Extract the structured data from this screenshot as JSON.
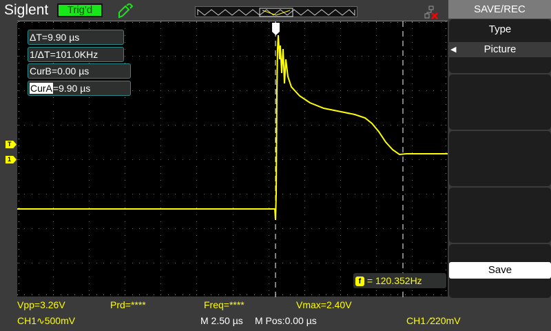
{
  "header": {
    "brand": "Siglent",
    "trigger_status": "Trig'd",
    "icons": [
      "probe-icon",
      "network-disconnected-icon"
    ]
  },
  "cursors": {
    "delta_t": "ΔT=9.90 µs",
    "inv_delta_t": "1/ΔT=101.0KHz",
    "cur_b": "CurB=0.00 µs",
    "cur_a_label": "CurA",
    "cur_a_value": "=9.90 µs"
  },
  "frequency_counter": {
    "icon": "f",
    "value": "= 120.352Hz"
  },
  "measurements": {
    "vpp": "Vpp=3.26V",
    "prd": "Prd=****",
    "freq": "Freq=****",
    "vmax": "Vmax=2.40V"
  },
  "status": {
    "ch1_scale": "CH1∿500mV",
    "timebase": "M 2.50 µs",
    "mpos": "M Pos:0.00 µs",
    "trigger": "CH1 ⁄220mV"
  },
  "markers": {
    "trigger_level": "T",
    "channel": "1"
  },
  "menu": {
    "title": "SAVE/REC",
    "type_label": "Type",
    "type_value": "Picture",
    "save_label": "Save"
  },
  "colors": {
    "trace": "#ffff00",
    "trig_status": "#19e619"
  }
}
